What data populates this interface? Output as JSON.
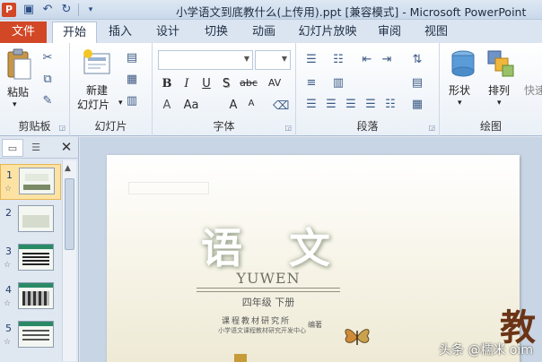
{
  "window": {
    "title": "小学语文到底教什么(上传用).ppt [兼容模式] - Microsoft PowerPoint"
  },
  "ribbon_tabs": {
    "file": "文件",
    "items": [
      "开始",
      "插入",
      "设计",
      "切换",
      "动画",
      "幻灯片放映",
      "审阅",
      "视图"
    ],
    "active": "开始"
  },
  "clipboard": {
    "paste": "粘贴",
    "group": "剪贴板"
  },
  "slides_group": {
    "new_slide_1": "新建",
    "new_slide_2": "幻灯片",
    "group": "幻灯片"
  },
  "font_group": {
    "bold": "B",
    "italic": "I",
    "underline": "U",
    "shadow": "S",
    "strike": "abc",
    "spacing": "AV",
    "color": "A",
    "case": "Aa",
    "grow": "A",
    "shrink": "A",
    "group": "字体"
  },
  "paragraph_group": {
    "group": "段落"
  },
  "drawing_group": {
    "shape": "形状",
    "arrange": "排列",
    "quick": "快速",
    "group": "绘图"
  },
  "slide_panel": {
    "slides": [
      {
        "number": "1",
        "selected": true
      },
      {
        "number": "2",
        "selected": false
      },
      {
        "number": "3",
        "selected": false
      },
      {
        "number": "4",
        "selected": false
      },
      {
        "number": "5",
        "selected": false
      }
    ]
  },
  "slide": {
    "main": "语 文",
    "pinyin": "YUWEN",
    "grade": "四年级  下册",
    "publisher": "课程教材研究所",
    "publisher_sub": "小学语文课程教材研究开发中心",
    "editor": "编著"
  },
  "watermark": "头条 @糯米 oim",
  "colors": {
    "accent": "#d24726",
    "ribbon": "#dbe5f1",
    "selection": "#fce3a3"
  }
}
